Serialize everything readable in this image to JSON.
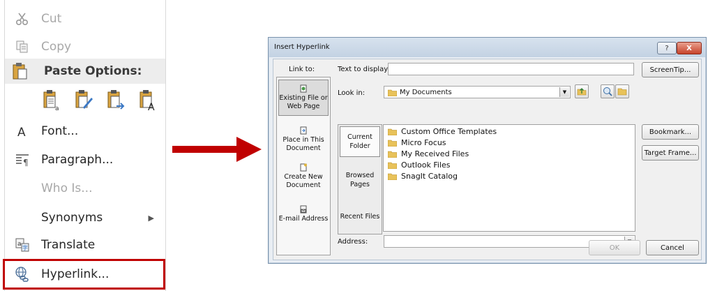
{
  "context_menu": {
    "items": {
      "cut": "Cut",
      "copy": "Copy",
      "paste_options": "Paste Options:",
      "font": "Font...",
      "paragraph": "Paragraph...",
      "who_is": "Who Is...",
      "synonyms": "Synonyms",
      "translate": "Translate",
      "hyperlink": "Hyperlink..."
    },
    "paste_icon_names": [
      "keep-source-formatting-icon",
      "merge-formatting-icon",
      "picture-paste-icon",
      "keep-text-only-icon"
    ],
    "highlight_color": "#c00000"
  },
  "arrow_color": "#c00000",
  "dialog": {
    "title": "Insert Hyperlink",
    "help_label": "?",
    "close_label": "X",
    "link_to_label": "Link to:",
    "link_to_items": {
      "existing": "Existing File or Web Page",
      "place": "Place in This Document",
      "create_new": "Create New Document",
      "email": "E-mail Address"
    },
    "text_to_display_label": "Text to display:",
    "text_to_display_value": "",
    "screentip_label": "ScreenTip...",
    "look_in_label": "Look in:",
    "look_in_value": "My Documents",
    "side_items": {
      "current_folder": "Current Folder",
      "browsed_pages": "Browsed Pages",
      "recent_files": "Recent Files"
    },
    "files": [
      "Custom Office Templates",
      "Micro Focus",
      "My Received Files",
      "Outlook Files",
      "SnagIt Catalog"
    ],
    "bookmark_label": "Bookmark...",
    "target_frame_label": "Target Frame...",
    "address_label": "Address:",
    "address_value": "",
    "ok_label": "OK",
    "cancel_label": "Cancel"
  }
}
